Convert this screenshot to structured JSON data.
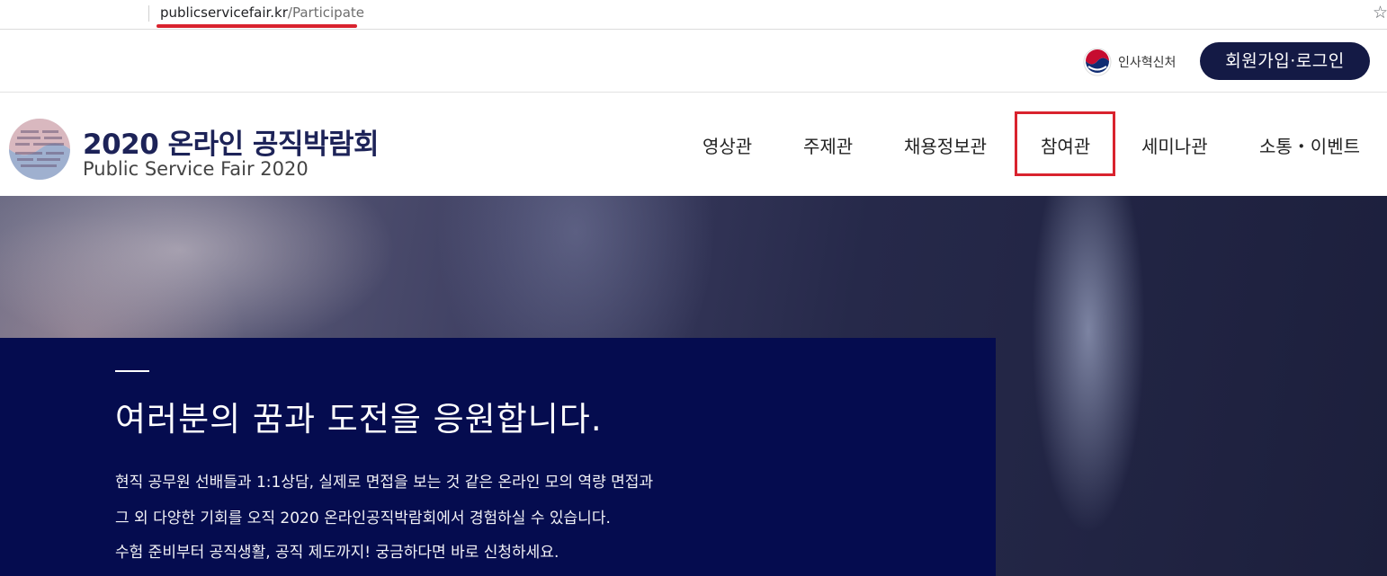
{
  "browser": {
    "url_domain": "publicservicefair.kr",
    "url_path": "/Participate",
    "bookmark_icon": "star-outline"
  },
  "utility": {
    "ministry_name": "인사혁신처",
    "login_label": "회원가입·로그인"
  },
  "header": {
    "title": "2020 온라인 공직박람회",
    "subtitle": "Public Service Fair 2020",
    "nav": [
      {
        "label": "영상관"
      },
      {
        "label": "주제관"
      },
      {
        "label": "채용정보관"
      },
      {
        "label": "참여관",
        "highlighted": true
      },
      {
        "label": "세미나관"
      },
      {
        "label": "소통・이벤트"
      }
    ]
  },
  "hero": {
    "heading": "여러분의 꿈과 도전을 응원합니다.",
    "lines": [
      "현직 공무원 선배들과 1:1상담, 실제로 면접을 보는 것 같은 온라인 모의 역량 면접과",
      "그 외 다양한 기회를 오직 2020 온라인공직박람회에서 경험하실 수 있습니다.",
      "수험 준비부터 공직생활, 공직 제도까지! 궁금하다면 바로 신청하세요."
    ]
  },
  "colors": {
    "navy": "#141a45",
    "hero_panel": "#050c4f",
    "highlight_red": "#d9232e"
  }
}
